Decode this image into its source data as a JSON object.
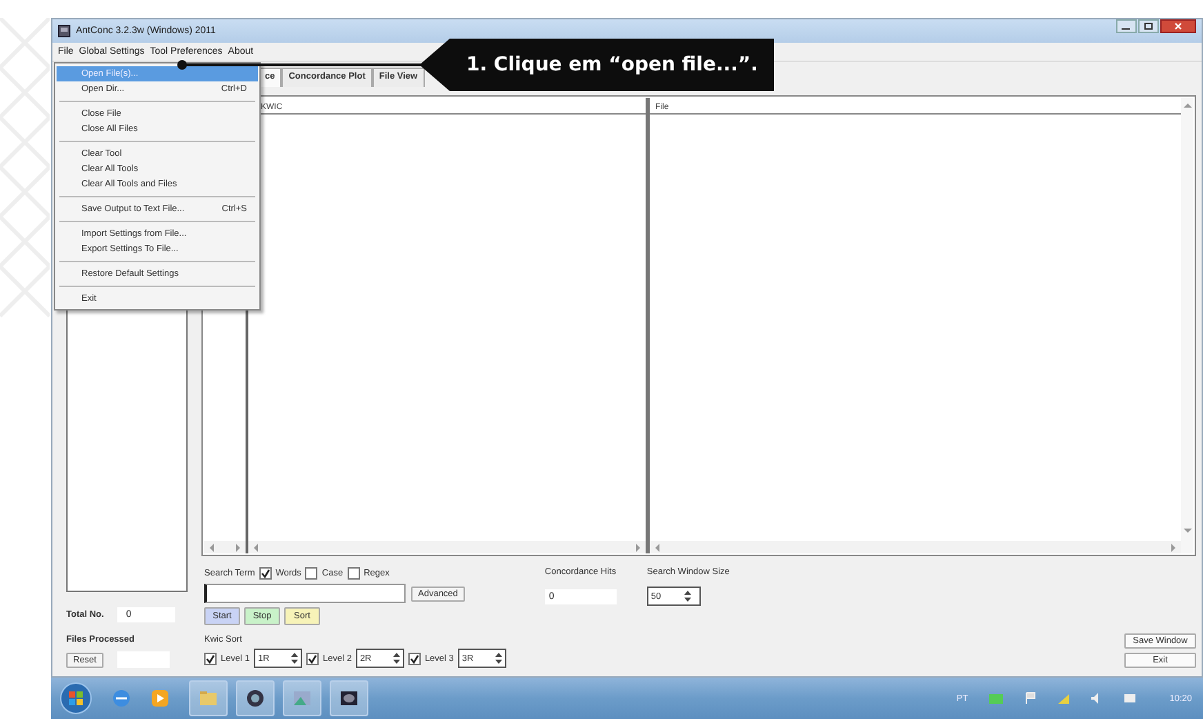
{
  "window": {
    "title": "AntConc 3.2.3w (Windows) 2011"
  },
  "menu_bar": [
    "File",
    "Global Settings",
    "Tool Preferences",
    "About"
  ],
  "file_menu": {
    "groups": [
      [
        {
          "label": "Open File(s)...",
          "selected": true
        },
        {
          "label": "Open Dir...",
          "shortcut": "Ctrl+D",
          "selected": false
        }
      ],
      [
        {
          "label": "Close File",
          "selected": false
        },
        {
          "label": "Close All Files",
          "selected": false
        }
      ],
      [
        {
          "label": "Clear Tool",
          "selected": false
        },
        {
          "label": "Clear All Tools",
          "selected": false
        },
        {
          "label": "Clear All Tools and Files",
          "selected": false
        }
      ],
      [
        {
          "label": "Save Output to Text File...",
          "shortcut": "Ctrl+S",
          "selected": false
        }
      ],
      [
        {
          "label": "Import Settings from File...",
          "selected": false
        },
        {
          "label": "Export Settings To File...",
          "selected": false
        }
      ],
      [
        {
          "label": "Restore Default Settings",
          "selected": false
        }
      ],
      [
        {
          "label": "Exit",
          "selected": false
        }
      ]
    ]
  },
  "tabs": [
    {
      "label": "ce",
      "selected": true
    },
    {
      "label": "Concordance Plot",
      "selected": false
    },
    {
      "label": "File View",
      "selected": false
    }
  ],
  "kwic_pane": {
    "header": "KWIC"
  },
  "file_pane": {
    "header": "File"
  },
  "left_panel": {
    "total_label": "Total No.",
    "total_value": "0",
    "files_label": "Files Processed",
    "reset": "Reset"
  },
  "search": {
    "label": "Search Term",
    "options": [
      {
        "label": "Words",
        "checked": true
      },
      {
        "label": "Case",
        "checked": false
      },
      {
        "label": "Regex",
        "checked": false
      }
    ],
    "advanced": "Advanced",
    "hits_label": "Concordance Hits",
    "hits_value": "0",
    "window_size_label": "Search Window Size",
    "window_size": "50"
  },
  "actions": [
    {
      "label": "Start",
      "color": "#c9d3f5"
    },
    {
      "label": "Stop",
      "color": "#c9f2c9"
    },
    {
      "label": "Sort",
      "color": "#f7f3b8"
    }
  ],
  "kwic_sort": {
    "label": "Kwic Sort",
    "levels": [
      {
        "label": "Level 1",
        "checked": true,
        "value": "1R"
      },
      {
        "label": "Level 2",
        "checked": true,
        "value": "2R"
      },
      {
        "label": "Level 3",
        "checked": true,
        "value": "3R"
      }
    ]
  },
  "side_buttons": [
    "Save Window",
    "Exit"
  ],
  "callout": {
    "text": "1. Clique em “open file...”."
  },
  "taskbar": {
    "language": "PT",
    "time": "10:20"
  }
}
